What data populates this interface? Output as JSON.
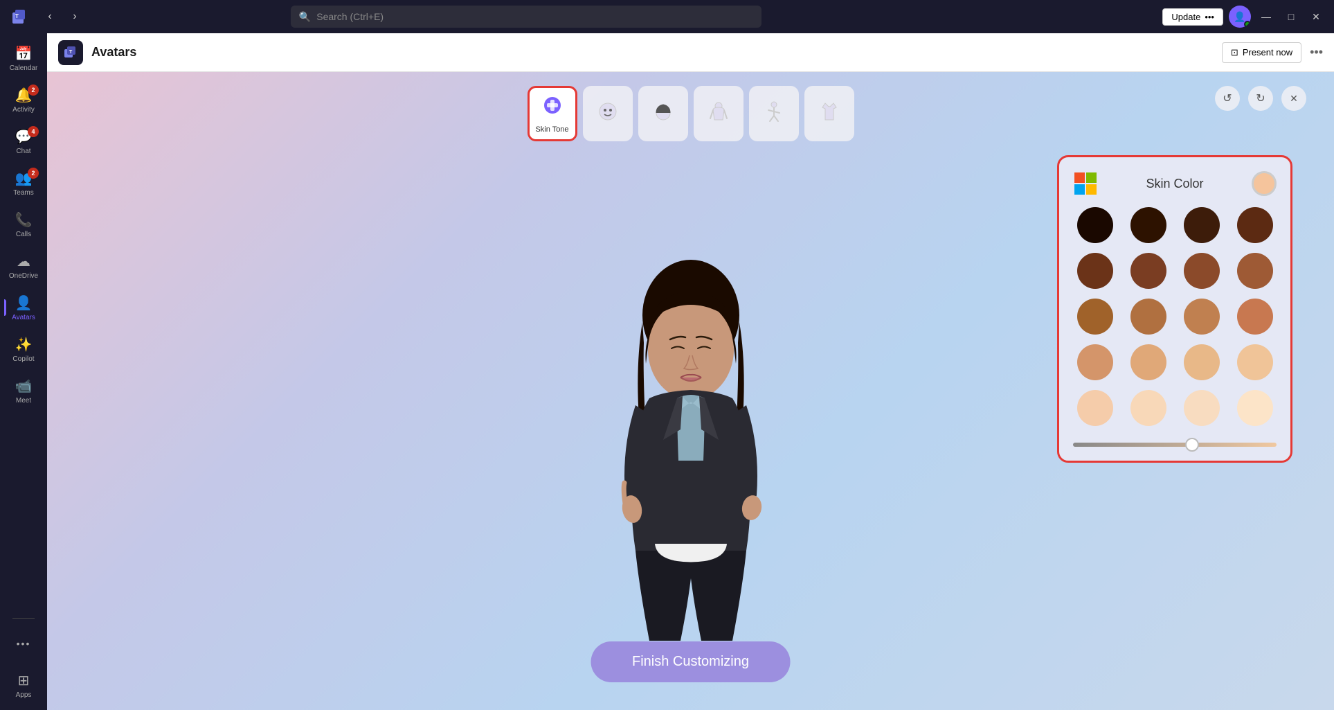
{
  "titleBar": {
    "searchPlaceholder": "Search (Ctrl+E)",
    "updateLabel": "Update",
    "updateMore": "•••",
    "minimize": "—",
    "maximize": "□",
    "close": "✕"
  },
  "sidebar": {
    "items": [
      {
        "id": "calendar",
        "label": "Calendar",
        "icon": "📅",
        "badge": null,
        "active": false
      },
      {
        "id": "activity",
        "label": "Activity",
        "icon": "🔔",
        "badge": "2",
        "active": false
      },
      {
        "id": "chat",
        "label": "Chat",
        "icon": "💬",
        "badge": "4",
        "active": false
      },
      {
        "id": "teams",
        "label": "Teams",
        "icon": "👥",
        "badge": "2",
        "active": false
      },
      {
        "id": "calls",
        "label": "Calls",
        "icon": "📞",
        "badge": null,
        "active": false
      },
      {
        "id": "onedrive",
        "label": "OneDrive",
        "icon": "☁",
        "badge": null,
        "active": false
      },
      {
        "id": "avatars",
        "label": "Avatars",
        "icon": "👤",
        "badge": null,
        "active": true
      },
      {
        "id": "copilot",
        "label": "Copilot",
        "icon": "✨",
        "badge": null,
        "active": false
      },
      {
        "id": "meet",
        "label": "Meet",
        "icon": "📹",
        "badge": null,
        "active": false
      },
      {
        "id": "more",
        "label": "•••",
        "icon": "•••",
        "badge": null,
        "active": false
      },
      {
        "id": "apps",
        "label": "Apps",
        "icon": "⊞",
        "badge": null,
        "active": false
      }
    ]
  },
  "appHeader": {
    "title": "Avatars",
    "presentNow": "Present now",
    "more": "•••"
  },
  "toolbar": {
    "items": [
      {
        "id": "skin-tone",
        "label": "Skin Tone",
        "icon": "🎨",
        "active": true
      },
      {
        "id": "face",
        "label": "",
        "icon": "😊",
        "active": false
      },
      {
        "id": "hair",
        "label": "",
        "icon": "👤",
        "active": false
      },
      {
        "id": "body",
        "label": "",
        "icon": "👔",
        "active": false
      },
      {
        "id": "pose",
        "label": "",
        "icon": "🤸",
        "active": false
      },
      {
        "id": "outfit",
        "label": "",
        "icon": "👕",
        "active": false
      }
    ],
    "undoTitle": "Undo",
    "redoTitle": "Redo",
    "closeTitle": "Close"
  },
  "finishButton": {
    "label": "Finish Customizing"
  },
  "skinPanel": {
    "title": "Skin Color",
    "selectedColor": "#f5c49c",
    "colors": [
      "#1a0800",
      "#2d1200",
      "#3d1c0a",
      "#5c2a12",
      "#6b3318",
      "#7a3d22",
      "#8b4a2a",
      "#9e5a35",
      "#a0622a",
      "#b07040",
      "#c08050",
      "#c87850",
      "#d4956a",
      "#e0a878",
      "#e8b888",
      "#f0c498",
      "#f5ccaa",
      "#f8d8b8",
      "#f8dcc0",
      "#fce4c8"
    ],
    "sliderValue": 55
  }
}
